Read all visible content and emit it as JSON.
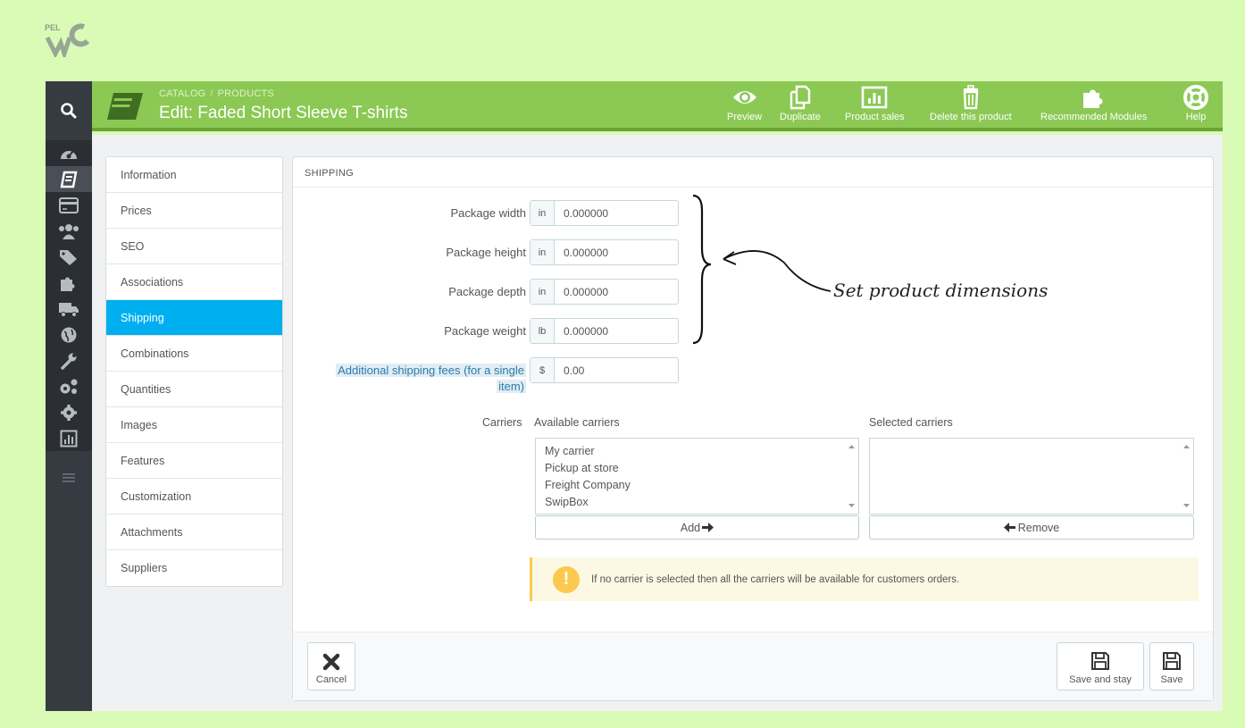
{
  "header": {
    "breadcrumb": [
      "CATALOG",
      "PRODUCTS"
    ],
    "title": "Edit: Faded Short Sleeve T-shirts",
    "toolbar": [
      {
        "label": "Preview",
        "icon": "eye-icon"
      },
      {
        "label": "Duplicate",
        "icon": "copy-icon"
      },
      {
        "label": "Product sales",
        "icon": "chart-icon"
      },
      {
        "label": "Delete this product",
        "icon": "trash-icon"
      },
      {
        "label": "Recommended Modules",
        "icon": "puzzle-icon"
      },
      {
        "label": "Help",
        "icon": "lifebuoy-icon"
      }
    ]
  },
  "tabs": [
    "Information",
    "Prices",
    "SEO",
    "Associations",
    "Shipping",
    "Combinations",
    "Quantities",
    "Images",
    "Features",
    "Customization",
    "Attachments",
    "Suppliers"
  ],
  "active_tab": "Shipping",
  "panel": {
    "heading": "SHIPPING",
    "fields": [
      {
        "label": "Package width",
        "unit": "in",
        "value": "0.000000"
      },
      {
        "label": "Package height",
        "unit": "in",
        "value": "0.000000"
      },
      {
        "label": "Package depth",
        "unit": "in",
        "value": "0.000000"
      },
      {
        "label": "Package weight",
        "unit": "lb",
        "value": "0.000000"
      }
    ],
    "additional_fees": {
      "label_line1": "Additional shipping fees (for a single",
      "label_line2": "item)",
      "unit": "$",
      "value": "0.00"
    },
    "carriers": {
      "label": "Carriers",
      "available_label": "Available carriers",
      "selected_label": "Selected carriers",
      "available": [
        "My carrier",
        "Pickup at store",
        "Freight Company",
        "SwipBox"
      ],
      "selected": [],
      "add_label": "Add",
      "remove_label": "Remove"
    },
    "alert": "If no carrier is selected then all the carriers will be available for customers orders."
  },
  "footer": {
    "cancel": "Cancel",
    "save_and_stay": "Save and stay",
    "save": "Save"
  },
  "annotation": "Set product dimensions",
  "colors": {
    "header_green": "#8bc954",
    "active_tab": "#00aff0",
    "sidebar": "#363a41",
    "alert": "#fcc94f"
  }
}
